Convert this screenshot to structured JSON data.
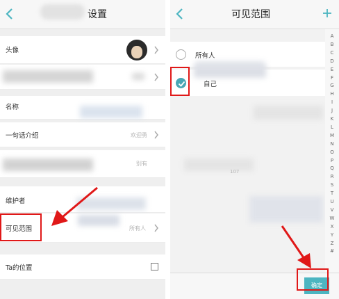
{
  "left_screen": {
    "header": {
      "title": "设置"
    },
    "rows": {
      "avatar_label": "头像",
      "name_label": "名称",
      "intro_label": "一句话介绍",
      "intro_value": "欢迎勇",
      "row4_value": "别有",
      "maintainer_label": "维护者",
      "visible_range_label": "可见范围",
      "visible_range_value": "所有人",
      "location_label": "Ta的位置"
    }
  },
  "right_screen": {
    "header": {
      "title": "可见范围"
    },
    "options": [
      {
        "label": "所有人",
        "checked": false
      },
      {
        "label": "自己",
        "checked": true
      }
    ],
    "faint_text": "107",
    "index_letters": [
      "A",
      "B",
      "C",
      "D",
      "E",
      "F",
      "G",
      "H",
      "I",
      "J",
      "K",
      "L",
      "M",
      "N",
      "O",
      "P",
      "Q",
      "R",
      "S",
      "T",
      "U",
      "V",
      "W",
      "X",
      "Y",
      "Z",
      "#"
    ],
    "confirm_button": "确定"
  },
  "colors": {
    "accent": "#4cb5c1",
    "highlight_red": "#e01818",
    "radio_checked": "#48a7b5"
  },
  "icons": [
    "back-arrow-icon",
    "chevron-right-icon",
    "plus-icon",
    "checkmark-icon"
  ]
}
